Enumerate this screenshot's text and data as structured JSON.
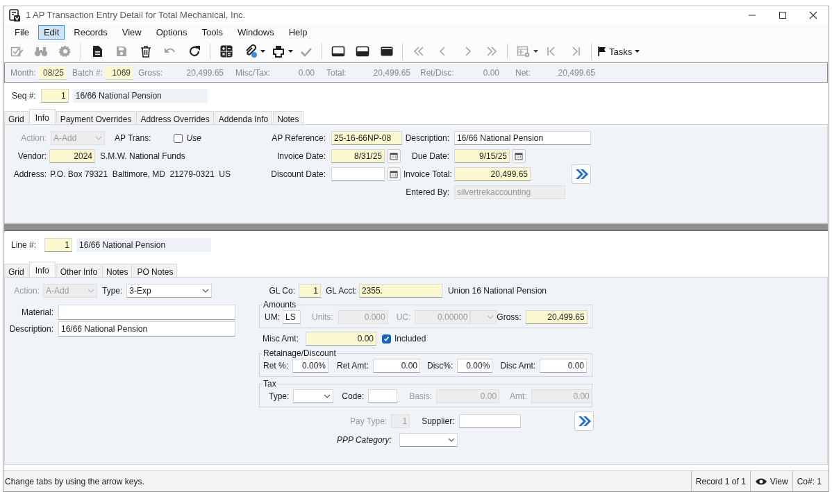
{
  "window": {
    "title": "1 AP Transaction Entry Detail for Total Mechanical, Inc."
  },
  "menu": [
    {
      "label": "File",
      "selected": false
    },
    {
      "label": "Edit",
      "selected": true
    },
    {
      "label": "Records",
      "selected": false
    },
    {
      "label": "View",
      "selected": false
    },
    {
      "label": "Options",
      "selected": false
    },
    {
      "label": "Tools",
      "selected": false
    },
    {
      "label": "Windows",
      "selected": false
    },
    {
      "label": "Help",
      "selected": false
    }
  ],
  "toolbar": [
    {
      "disabled": true
    },
    {
      "disabled": true
    },
    {
      "disabled": true
    },
    {
      "disabled": false
    },
    {
      "disabled": true
    },
    {
      "disabled": false
    },
    {
      "disabled": true
    },
    {
      "disabled": false
    },
    {
      "disabled": false
    },
    {
      "disabled": false
    },
    {
      "disabled": false
    },
    {
      "disabled": true
    },
    {
      "disabled": false
    },
    {
      "disabled": false
    },
    {
      "disabled": false
    },
    {
      "disabled": true
    },
    {
      "disabled": true
    },
    {
      "disabled": true
    },
    {
      "disabled": true
    },
    {
      "disabled": true
    },
    {
      "disabled": true
    },
    {
      "disabled": true
    }
  ],
  "tasks": {
    "label": "Tasks"
  },
  "batch_bar": [
    {
      "label": "Month:",
      "value": "08/25",
      "required": true
    },
    {
      "label": "Batch #:",
      "value": "1069",
      "required": true
    },
    {
      "label": "Gross:",
      "value": "20,499.65",
      "required": false
    },
    {
      "label": "Misc/Tax:",
      "value": "0.00",
      "required": false
    },
    {
      "label": "Total:",
      "value": "20,499.65",
      "required": false
    },
    {
      "label": "Ret/Disc:",
      "value": "0.00",
      "required": false
    },
    {
      "label": "Net:",
      "value": "20,499.65",
      "required": false
    }
  ],
  "header_seq": {
    "label": "Seq #:",
    "value": "1",
    "description": "16/66 National Pension"
  },
  "header_tabs": [
    {
      "label": "Grid",
      "selected": false
    },
    {
      "label": "Info",
      "selected": true
    },
    {
      "label": "Payment Overrides",
      "selected": false
    },
    {
      "label": "Address Overrides",
      "selected": false
    },
    {
      "label": "Addenda Info",
      "selected": false
    },
    {
      "label": "Notes",
      "selected": false
    }
  ],
  "header_form": {
    "action": {
      "label": "Action:",
      "value": "A-Add",
      "kind": "select",
      "disabled": true
    },
    "ap_trans": {
      "label": "AP Trans:",
      "kind": "check",
      "checked": false,
      "caption": "Use"
    },
    "vendor": {
      "label": "Vendor:",
      "value": "2024",
      "kind": "number",
      "required": true,
      "disabled": false,
      "name": "S.M.W. National Funds"
    },
    "address": {
      "label": "Address:",
      "value": "P.O. Box 79321  Baltimore, MD  21279-0321  US"
    },
    "ap_reference": {
      "label": "AP Reference:",
      "value": "25-16-66NP-08",
      "kind": "text",
      "required": true,
      "disabled": false
    },
    "invoice_date": {
      "label": "Invoice Date:",
      "value": "8/31/25",
      "kind": "date",
      "required": true,
      "disabled": false
    },
    "discount_date": {
      "label": "Discount Date:",
      "kind": "date",
      "required": false,
      "disabled": false
    },
    "description": {
      "label": "Description:",
      "value": "16/66 National Pension",
      "kind": "text",
      "required": false,
      "disabled": false
    },
    "due_date": {
      "label": "Due Date:",
      "value": "9/15/25",
      "kind": "date",
      "required": true,
      "disabled": false
    },
    "invoice_total": {
      "label": "Invoice Total:",
      "value": "20,499.65",
      "kind": "number",
      "required": true,
      "disabled": false
    },
    "entered_by": {
      "label": "Entered By:",
      "value": "silvertrekaccounting",
      "kind": "display"
    }
  },
  "line_seq": {
    "label": "Line #:",
    "value": "1",
    "description": "16/66 National Pension"
  },
  "line_tabs": [
    {
      "label": "Grid",
      "selected": false
    },
    {
      "label": "Info",
      "selected": true
    },
    {
      "label": "Other Info",
      "selected": false
    },
    {
      "label": "Notes",
      "selected": false
    },
    {
      "label": "PO Notes",
      "selected": false
    }
  ],
  "line_form": {
    "action": {
      "label": "Action:",
      "value": "A-Add",
      "kind": "select",
      "disabled": true
    },
    "type": {
      "label": "Type:",
      "value": "3-Exp",
      "kind": "select",
      "required": false,
      "disabled": false
    },
    "material": {
      "label": "Material:",
      "kind": "text",
      "required": false,
      "disabled": false
    },
    "description": {
      "label": "Description:",
      "value": "16/66 National Pension",
      "kind": "text",
      "required": false,
      "disabled": false
    },
    "gl_co": {
      "label": "GL Co:",
      "value": "1",
      "kind": "number",
      "required": true,
      "disabled": false
    },
    "gl_acct": {
      "label": "GL Acct:",
      "value": "2355.",
      "kind": "text",
      "required": true,
      "disabled": false,
      "name": "Union 16 National Pension"
    },
    "amounts": {
      "title": "Amounts",
      "um": {
        "label": "UM:",
        "value": "LS",
        "kind": "text",
        "required": false,
        "disabled": false
      },
      "units": {
        "label": "Units:",
        "value": "0.000",
        "kind": "number",
        "disabled": true
      },
      "uc": {
        "label": "UC:",
        "value": "0.00000",
        "kind": "number",
        "disabled": true
      },
      "uc_unit": {
        "kind": "select",
        "disabled": true
      },
      "gross": {
        "label": "Gross:",
        "value": "20,499.65",
        "kind": "number",
        "required": true,
        "disabled": false
      }
    },
    "misc_amt": {
      "label": "Misc Amt:",
      "value": "0.00",
      "kind": "number",
      "required": true,
      "disabled": false
    },
    "included": {
      "kind": "check",
      "checked": true,
      "caption": "Included"
    },
    "retainage": {
      "title": "Retainage/Discount",
      "ret_pct": {
        "label": "Ret %:",
        "value": "0.00%",
        "kind": "number",
        "required": false,
        "disabled": false
      },
      "ret_amt": {
        "label": "Ret Amt:",
        "value": "0.00",
        "kind": "number",
        "required": false,
        "disabled": false
      },
      "disc_pct": {
        "label": "Disc%:",
        "value": "0.00%",
        "kind": "number",
        "required": false,
        "disabled": false
      },
      "disc_amt": {
        "label": "Disc Amt:",
        "value": "0.00",
        "kind": "number",
        "required": false,
        "disabled": false
      }
    },
    "tax": {
      "title": "Tax",
      "type": {
        "label": "Type:",
        "kind": "select",
        "required": false,
        "disabled": false
      },
      "code": {
        "label": "Code:",
        "kind": "text",
        "required": false,
        "disabled": false
      },
      "basis": {
        "label": "Basis:",
        "value": "0.00",
        "kind": "number",
        "disabled": true
      },
      "amt": {
        "label": "Amt:",
        "value": "0.00",
        "kind": "number",
        "disabled": true
      }
    },
    "pay_type": {
      "label": "Pay Type:",
      "value": "1",
      "kind": "number",
      "disabled": true
    },
    "supplier": {
      "label": "Supplier:",
      "kind": "text",
      "required": false,
      "disabled": false
    },
    "ppp_category": {
      "label": "PPP Category:",
      "kind": "select",
      "required": false,
      "disabled": false
    }
  },
  "status_bar": {
    "message": "Change tabs by using the arrow keys.",
    "record": "Record 1 of 1",
    "mode": "View",
    "company": "Co#: 1"
  }
}
